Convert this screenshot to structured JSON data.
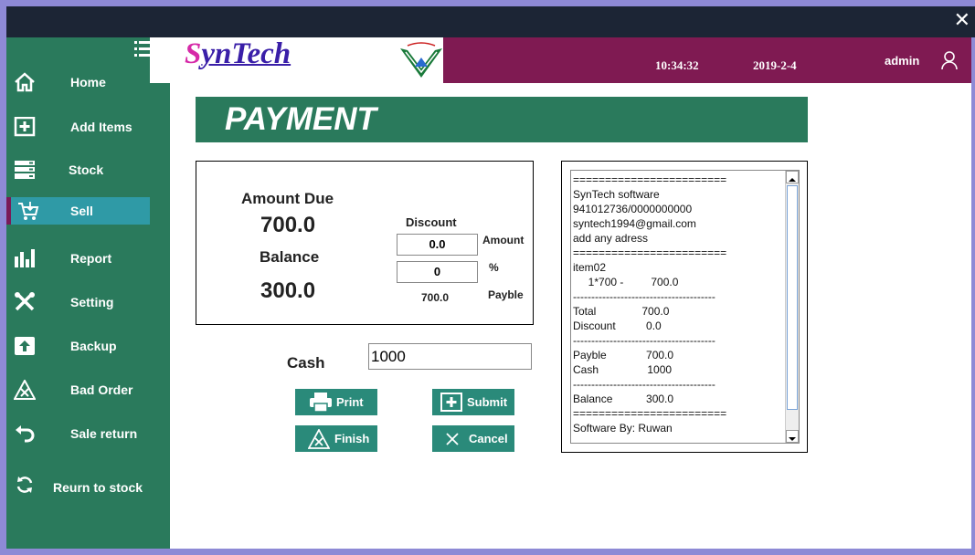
{
  "window": {
    "close_glyph": "✕"
  },
  "sidebar": {
    "items": [
      {
        "label": "Home",
        "icon": "home-icon"
      },
      {
        "label": "Add Items",
        "icon": "add-box-icon"
      },
      {
        "label": "Stock",
        "icon": "stock-icon"
      },
      {
        "label": "Sell",
        "icon": "cart-icon",
        "active": true
      },
      {
        "label": "Report",
        "icon": "bar-chart-icon"
      },
      {
        "label": "Setting",
        "icon": "tools-icon"
      },
      {
        "label": "Backup",
        "icon": "upload-icon"
      },
      {
        "label": "Bad Order",
        "icon": "warning-x-icon"
      },
      {
        "label": "Sale return",
        "icon": "undo-icon"
      },
      {
        "label": "Reurn to stock",
        "icon": "refresh-icon"
      }
    ]
  },
  "header": {
    "logo_s": "S",
    "logo_rest": "ynTech",
    "time": "10:34:32",
    "date": "2019-2-4",
    "user": "admin"
  },
  "page": {
    "title": "PAYMENT"
  },
  "payment": {
    "amount_due_label": "Amount Due",
    "amount_due": "700.0",
    "balance_label": "Balance",
    "balance": "300.0",
    "discount_label": "Discount",
    "discount_amount": "0.0",
    "discount_amount_label": "Amount",
    "discount_percent": "0",
    "percent_label": "%",
    "payable": "700.0",
    "payable_label": "Payble",
    "cash_label": "Cash",
    "cash_value": "1000"
  },
  "buttons": {
    "print": "Print",
    "submit": "Submit",
    "finish": "Finish",
    "cancel": "Cancel"
  },
  "receipt": {
    "lines": [
      "========================",
      "SynTech software",
      "941012736/0000000000",
      "syntech1994@gmail.com",
      "add any adress",
      "========================",
      "item02",
      "     1*700 -         700.0",
      "---------------------------------------",
      "Total               700.0",
      "Discount          0.0",
      "---------------------------------------",
      "Payble             700.0",
      "Cash                1000",
      "---------------------------------------",
      "Balance           300.0",
      "========================",
      "Software By: Ruwan"
    ]
  },
  "colors": {
    "sidebar": "#2a7a5c",
    "active_item": "#2f9aa6",
    "header_bar": "#7f1a52",
    "button": "#2a8a7a"
  }
}
